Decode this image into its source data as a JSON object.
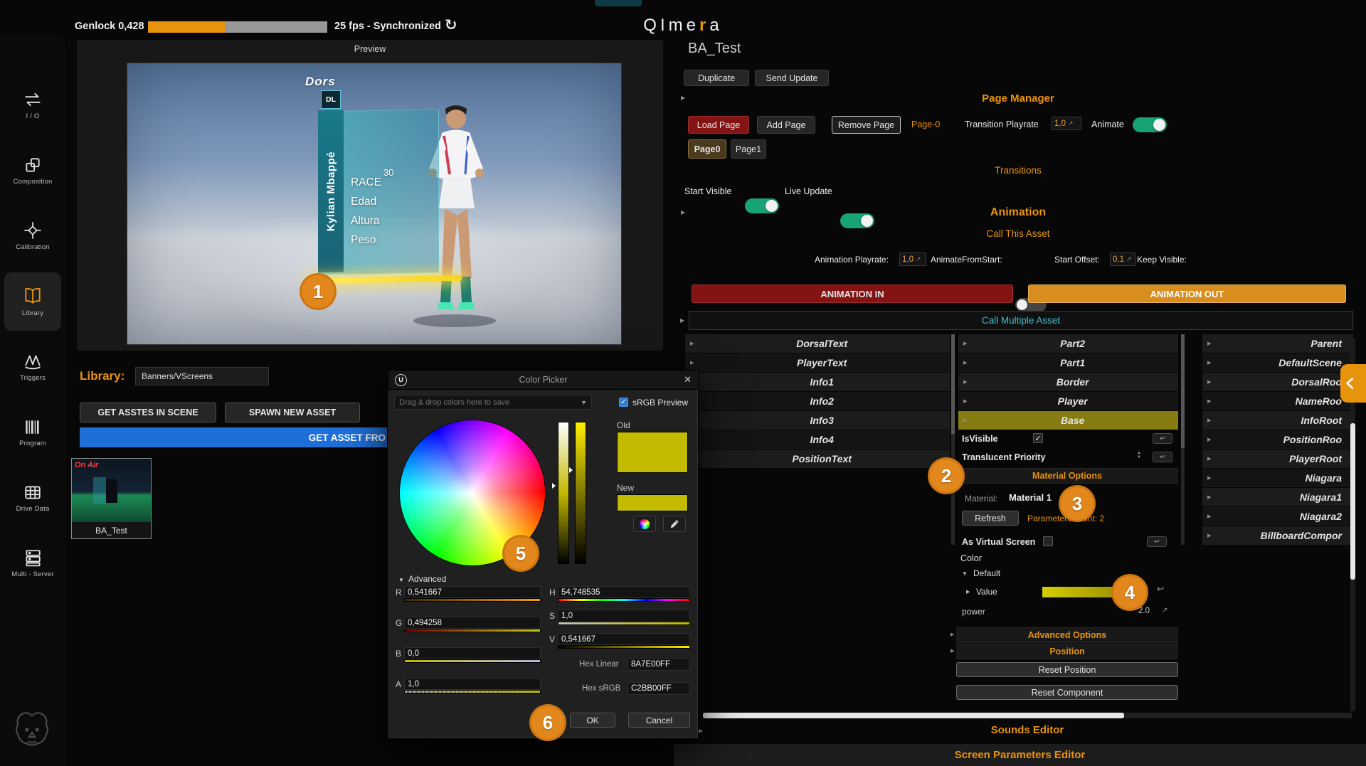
{
  "colors": {
    "accent_orange": "#e8930c",
    "dark_red": "#841414",
    "button_orange": "#d78e1e",
    "toggle_green": "#17a375",
    "cyan_text": "#3fc1d1",
    "olive_highlight": "#867c12",
    "blue_button": "#1f6fd8",
    "swatch_yellow": "#c2bb00"
  },
  "topbar": {
    "genlock_label": "Genlock 0,428",
    "progress_pct": 43,
    "fps_label": "25 fps - Synchronized",
    "logo_left": "QIme",
    "logo_accent": "r",
    "logo_right": "a"
  },
  "sidebar": {
    "items": [
      {
        "label": "I / O"
      },
      {
        "label": "Composition"
      },
      {
        "label": "Calibration"
      },
      {
        "label": "Library"
      },
      {
        "label": "Triggers"
      },
      {
        "label": "Program"
      },
      {
        "label": "Drive Data"
      },
      {
        "label": "Multi - Server"
      }
    ]
  },
  "preview": {
    "title": "Preview",
    "brand": "Dors",
    "dl_badge": "DL",
    "player_name": "Kylian Mbappé",
    "stat_1": "RACE",
    "stat_2": "Edad",
    "stat_3": "Altura",
    "stat_4": "Peso",
    "stat_value": "30"
  },
  "library": {
    "label": "Library:",
    "path_value": "Banners/VScreens",
    "get_assets_button": "GET ASSTES IN SCENE",
    "spawn_button": "SPAWN NEW ASSET",
    "get_asset_button": "GET ASSET FRO",
    "asset_on_air": "On Air",
    "asset_name": "BA_Test"
  },
  "panel": {
    "title": "BA_Test",
    "duplicate": "Duplicate",
    "send_update": "Send Update",
    "page_manager": "Page Manager",
    "load_page": "Load Page",
    "add_page": "Add Page",
    "remove_page": "Remove Page",
    "page_ref": "Page-0",
    "transition_playrate": "Transition Playrate",
    "transition_playrate_value": "1,0",
    "animate": "Animate",
    "tab_page0": "Page0",
    "tab_page1": "Page1",
    "transitions": "Transitions",
    "start_visible": "Start Visible",
    "live_update": "Live Update",
    "animation": "Animation",
    "call_this_asset": "Call This Asset",
    "anim_playrate": "Animation Playrate:",
    "anim_playrate_value": "1,0",
    "animate_from_start": "AnimateFromStart:",
    "start_offset": "Start Offset:",
    "start_offset_value": "0,1",
    "keep_visible": "Keep Visible:",
    "animation_in": "ANIMATION IN",
    "animation_out": "ANIMATION OUT",
    "call_multiple_asset": "Call Multiple Asset",
    "sounds_editor": "Sounds Editor",
    "screen_parameters_editor": "Screen Parameters Editor"
  },
  "tree_left": [
    "DorsalText",
    "PlayerText",
    "Info1",
    "Info2",
    "Info3",
    "Info4",
    "PositionText"
  ],
  "tree_mid": [
    "Part2",
    "Part1",
    "Border",
    "Player",
    "Base"
  ],
  "tree_right": [
    "Parent",
    "DefaultScene",
    "DorsalRoo",
    "NameRoo",
    "InfoRoot",
    "PositionRoo",
    "PlayerRoot",
    "Niagara",
    "Niagara1",
    "Niagara2",
    "BillboardCompor"
  ],
  "properties": {
    "is_visible": "IsVisible",
    "translucent_priority": "Translucent Priority",
    "material_options": "Material Options",
    "material_label": "Material:",
    "material_value": "Material 1",
    "refresh": "Refresh",
    "parameters_count": "Parameters count: 2",
    "as_virtual_screen": "As Virtual Screen",
    "color": "Color",
    "default": "Default",
    "value": "Value",
    "power": "power",
    "power_value": "2.0",
    "advanced_options": "Advanced Options",
    "position": "Position",
    "reset_position": "Reset Position",
    "reset_component": "Reset Component"
  },
  "color_picker": {
    "title": "Color Picker",
    "logo": "U",
    "drop_hint": "Drag & drop colors here to save",
    "srgb_preview": "sRGB Preview",
    "old": "Old",
    "new": "New",
    "advanced": "Advanced",
    "r_label": "R",
    "r_value": "0,541667",
    "g_label": "G",
    "g_value": "0,494258",
    "b_label": "B",
    "b_value": "0,0",
    "a_label": "A",
    "a_value": "1,0",
    "h_label": "H",
    "h_value": "54,748535",
    "s_label": "S",
    "s_value": "1,0",
    "v_label": "V",
    "v_value": "0,541667",
    "hex_linear_label": "Hex Linear",
    "hex_linear_value": "8A7E00FF",
    "hex_srgb_label": "Hex sRGB",
    "hex_srgb_value": "C2BB00FF",
    "ok": "OK",
    "cancel": "Cancel"
  },
  "annotations": {
    "n1": "1",
    "n2": "2",
    "n3": "3",
    "n4": "4",
    "n5": "5",
    "n6": "6"
  }
}
